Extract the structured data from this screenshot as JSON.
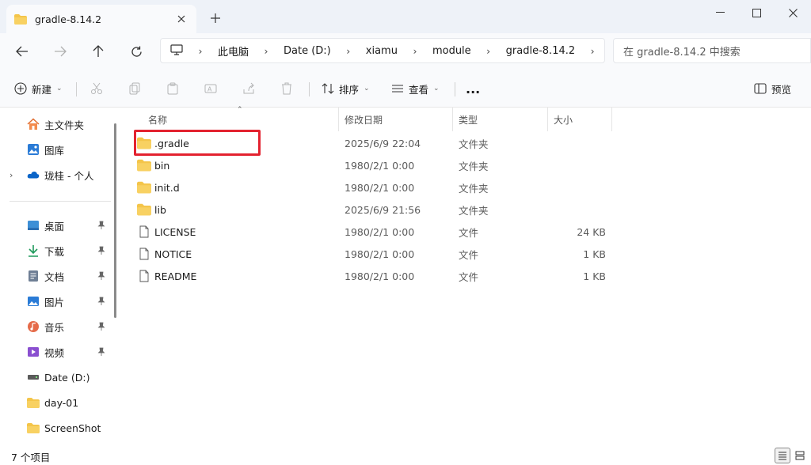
{
  "window": {
    "tab_title": "gradle-8.14.2",
    "new_tab_icon": "plus-icon",
    "controls": [
      "minimize-icon",
      "maximize-icon",
      "close-icon"
    ]
  },
  "nav": {
    "breadcrumbs": [
      "此电脑",
      "Date (D:)",
      "xiamu",
      "module",
      "gradle-8.14.2"
    ],
    "search_placeholder": "在 gradle-8.14.2 中搜索"
  },
  "toolbar": {
    "new_label": "新建",
    "sort_label": "排序",
    "view_label": "查看",
    "more_label": "...",
    "preview_label": "预览"
  },
  "sidebar": {
    "top": [
      {
        "label": "主文件夹",
        "icon": "home-icon"
      },
      {
        "label": "图库",
        "icon": "gallery-icon"
      },
      {
        "label": "珑桂 - 个人",
        "icon": "onedrive-icon"
      }
    ],
    "pinned": [
      {
        "label": "桌面",
        "icon": "desktop-icon"
      },
      {
        "label": "下载",
        "icon": "download-icon"
      },
      {
        "label": "文档",
        "icon": "documents-icon"
      },
      {
        "label": "图片",
        "icon": "pictures-icon"
      },
      {
        "label": "音乐",
        "icon": "music-icon"
      },
      {
        "label": "视频",
        "icon": "videos-icon"
      }
    ],
    "drives": [
      {
        "label": "Date (D:)",
        "icon": "drive-icon"
      },
      {
        "label": "day-01",
        "icon": "folder-icon"
      },
      {
        "label": "ScreenShot",
        "icon": "folder-icon"
      }
    ]
  },
  "columns": {
    "name": "名称",
    "date": "修改日期",
    "type": "类型",
    "size": "大小"
  },
  "files": [
    {
      "name": ".gradle",
      "date": "2025/6/9 22:04",
      "type": "文件夹",
      "size": "",
      "kind": "folder"
    },
    {
      "name": "bin",
      "date": "1980/2/1 0:00",
      "type": "文件夹",
      "size": "",
      "kind": "folder"
    },
    {
      "name": "init.d",
      "date": "1980/2/1 0:00",
      "type": "文件夹",
      "size": "",
      "kind": "folder"
    },
    {
      "name": "lib",
      "date": "2025/6/9 21:56",
      "type": "文件夹",
      "size": "",
      "kind": "folder"
    },
    {
      "name": "LICENSE",
      "date": "1980/2/1 0:00",
      "type": "文件",
      "size": "24 KB",
      "kind": "file"
    },
    {
      "name": "NOTICE",
      "date": "1980/2/1 0:00",
      "type": "文件",
      "size": "1 KB",
      "kind": "file"
    },
    {
      "name": "README",
      "date": "1980/2/1 0:00",
      "type": "文件",
      "size": "1 KB",
      "kind": "file"
    }
  ],
  "status": {
    "count": "7 个项目"
  },
  "colors": {
    "folder": "#f4c54a",
    "highlight": "#e3222f",
    "accent": "#0a64c8"
  }
}
